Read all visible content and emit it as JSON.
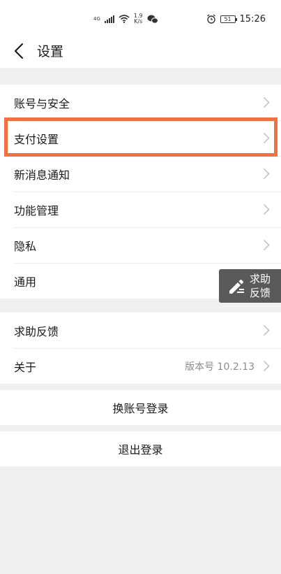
{
  "status_bar": {
    "signal_label": "4G",
    "net_speed_value": "1.9",
    "net_speed_unit": "K/s",
    "battery": "51",
    "time": "15:26"
  },
  "header": {
    "title": "设置"
  },
  "groups": {
    "first": {
      "items": [
        {
          "label": "账号与安全"
        },
        {
          "label": "支付设置"
        },
        {
          "label": "新消息通知"
        },
        {
          "label": "功能管理"
        },
        {
          "label": "隐私"
        },
        {
          "label": "通用"
        }
      ]
    },
    "second": {
      "items": [
        {
          "label": "求助反馈"
        },
        {
          "label": "关于",
          "value": "版本号 10.2.13"
        }
      ]
    }
  },
  "actions": {
    "switch_account": "换账号登录",
    "logout": "退出登录"
  },
  "help_float": {
    "line1": "求助",
    "line2": "反馈"
  },
  "colors": {
    "highlight": "#f07242",
    "background": "#f0f0f0",
    "float_bg": "#5a5a5a"
  }
}
